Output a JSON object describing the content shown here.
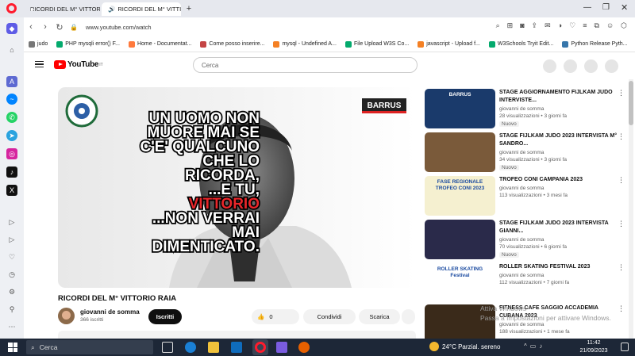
{
  "browser": {
    "tabs": [
      {
        "label": "RICORDI DEL M° VITTORI"
      },
      {
        "label": "RICORDI DEL M° VITTI"
      }
    ],
    "url": "www.youtube.com/watch",
    "bookmarks": [
      {
        "label": "judo",
        "color": "#777777"
      },
      {
        "label": "PHP mysqli error() F...",
        "color": "#04aa6d"
      },
      {
        "label": "Home - Documentat...",
        "color": "#ff7a3d"
      },
      {
        "label": "Come posso inserire...",
        "color": "#c44444"
      },
      {
        "label": "mysql - Undefined A...",
        "color": "#f48024"
      },
      {
        "label": "File Upload W3S Co...",
        "color": "#04aa6d"
      },
      {
        "label": "javascript - Upload f...",
        "color": "#f48024"
      },
      {
        "label": "W3Schools Tryit Edit...",
        "color": "#04aa6d"
      },
      {
        "label": "Python Release Pyth...",
        "color": "#3776ab"
      }
    ]
  },
  "youtube": {
    "logo": "YouTube",
    "country": "IT",
    "search_placeholder": "Cerca"
  },
  "video": {
    "title": "RICORDI DEL M° VITTORIO RAIA",
    "overlay_lines": [
      "UN UOMO NON",
      "MUORE MAI SE",
      "C'E' QUALCUNO",
      "CHE LO",
      "RICORDA,",
      "...E TU,",
      "VITTORIO",
      "...NON VERRAI",
      "MAI",
      "DIMENTICATO."
    ],
    "brand": "BARRUS",
    "channel": "giovanni de somma",
    "subscribers": "366 iscritti",
    "subscribe_label": "Iscritti",
    "likes": "0",
    "share_label": "Condividi",
    "download_label": "Scarica"
  },
  "recommended": [
    {
      "title": "STAGE AGGIORNAMENTO FIJLKAM JUDO INTERVISTE...",
      "channel": "giovanni de somma",
      "views": "28 visualizzazioni",
      "age": "3 giorni fa",
      "badge": "Nuovo",
      "thumb_color": "#1a3a6b",
      "thumb_text": "BARRUS"
    },
    {
      "title": "STAGE FIJLKAM JUDO 2023 INTERVISTA M° SANDRO...",
      "channel": "giovanni de somma",
      "views": "34 visualizzazioni",
      "age": "3 giorni fa",
      "badge": "Nuovo",
      "thumb_color": "#7a5a3a",
      "thumb_text": ""
    },
    {
      "title": "TROFEO CONI CAMPANIA 2023",
      "channel": "giovanni de somma",
      "views": "113 visualizzazioni",
      "age": "3 mesi fa",
      "badge": "",
      "thumb_color": "#f5f0d0",
      "thumb_text": "FASE REGIONALE TROFEO CONI 2023"
    },
    {
      "title": "STAGE FIJLKAM JUDO 2023 INTERVISTA GIANNI...",
      "channel": "giovanni de somma",
      "views": "70 visualizzazioni",
      "age": "6 giorni fa",
      "badge": "Nuovo",
      "thumb_color": "#2a2a4a",
      "thumb_text": ""
    },
    {
      "title": "ROLLER SKATING FESTIVAL 2023",
      "channel": "giovanni de somma",
      "views": "112 visualizzazioni",
      "age": "7 giorni fa",
      "badge": "",
      "thumb_color": "#ffffff",
      "thumb_text": "ROLLER SKATING Festival"
    },
    {
      "title": "FITNESS CAFE SAGGIO ACCADEMIA CUBANA 2023",
      "channel": "giovanni de somma",
      "views": "188 visualizzazioni",
      "age": "1 mese fa",
      "badge": "",
      "thumb_color": "#3a2a1a",
      "thumb_text": ""
    }
  ],
  "watermark": [
    "Attiva Windows",
    "Passa a Impostazioni per attivare Windows."
  ],
  "taskbar": {
    "search_label": "Cerca",
    "weather": "24°C  Parzial. sereno",
    "time": "11:42",
    "date": "21/09/2023"
  }
}
